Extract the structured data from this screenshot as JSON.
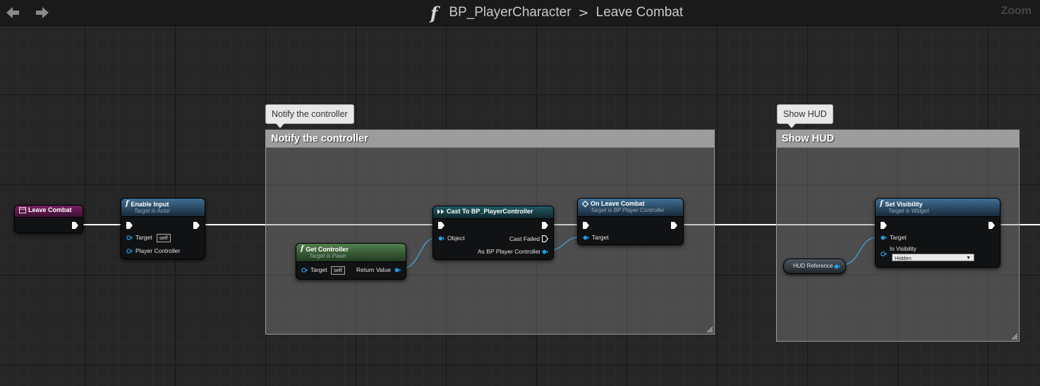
{
  "toolbar": {
    "back_icon": "arrow-left-icon",
    "forward_icon": "arrow-right-icon",
    "function_glyph": "f",
    "breadcrumb": {
      "parent": "BP_PlayerCharacter",
      "separator": ">",
      "current": "Leave Combat"
    },
    "zoom_label": "Zoom"
  },
  "colors": {
    "exec_wire": "#ffffff",
    "object_wire": "#1ea0e6",
    "event_header": "#7a1f63",
    "function_header": "#406f93",
    "pure_header": "#53804d",
    "cast_header": "#1f5b66"
  },
  "comments": [
    {
      "bubble": "Notify the controller",
      "title": "Notify the controller"
    },
    {
      "bubble": "Show HUD",
      "title": "Show HUD"
    }
  ],
  "nodes": {
    "leave_combat": {
      "title": "Leave Combat"
    },
    "enable_input": {
      "title": "Enable Input",
      "subtitle": "Target is Actor",
      "pins": {
        "target": "Target",
        "target_default": "self",
        "player_controller": "Player Controller"
      }
    },
    "get_controller": {
      "title": "Get Controller",
      "subtitle": "Target is Pawn",
      "pins": {
        "target": "Target",
        "target_default": "self",
        "return_value": "Return Value"
      }
    },
    "cast": {
      "title": "Cast To BP_PlayerController",
      "pins": {
        "object": "Object",
        "cast_failed": "Cast Failed",
        "as_bp": "As BP Player Controller"
      }
    },
    "on_leave_combat": {
      "title": "On Leave Combat",
      "subtitle": "Target is BP Player Controller",
      "pins": {
        "target": "Target"
      }
    },
    "hud_reference": {
      "title": "HUD Reference"
    },
    "set_visibility": {
      "title": "Set Visibility",
      "subtitle": "Target is Widget",
      "pins": {
        "target": "Target",
        "in_visibility": "In Visibility",
        "in_visibility_value": "Hidden"
      }
    }
  }
}
